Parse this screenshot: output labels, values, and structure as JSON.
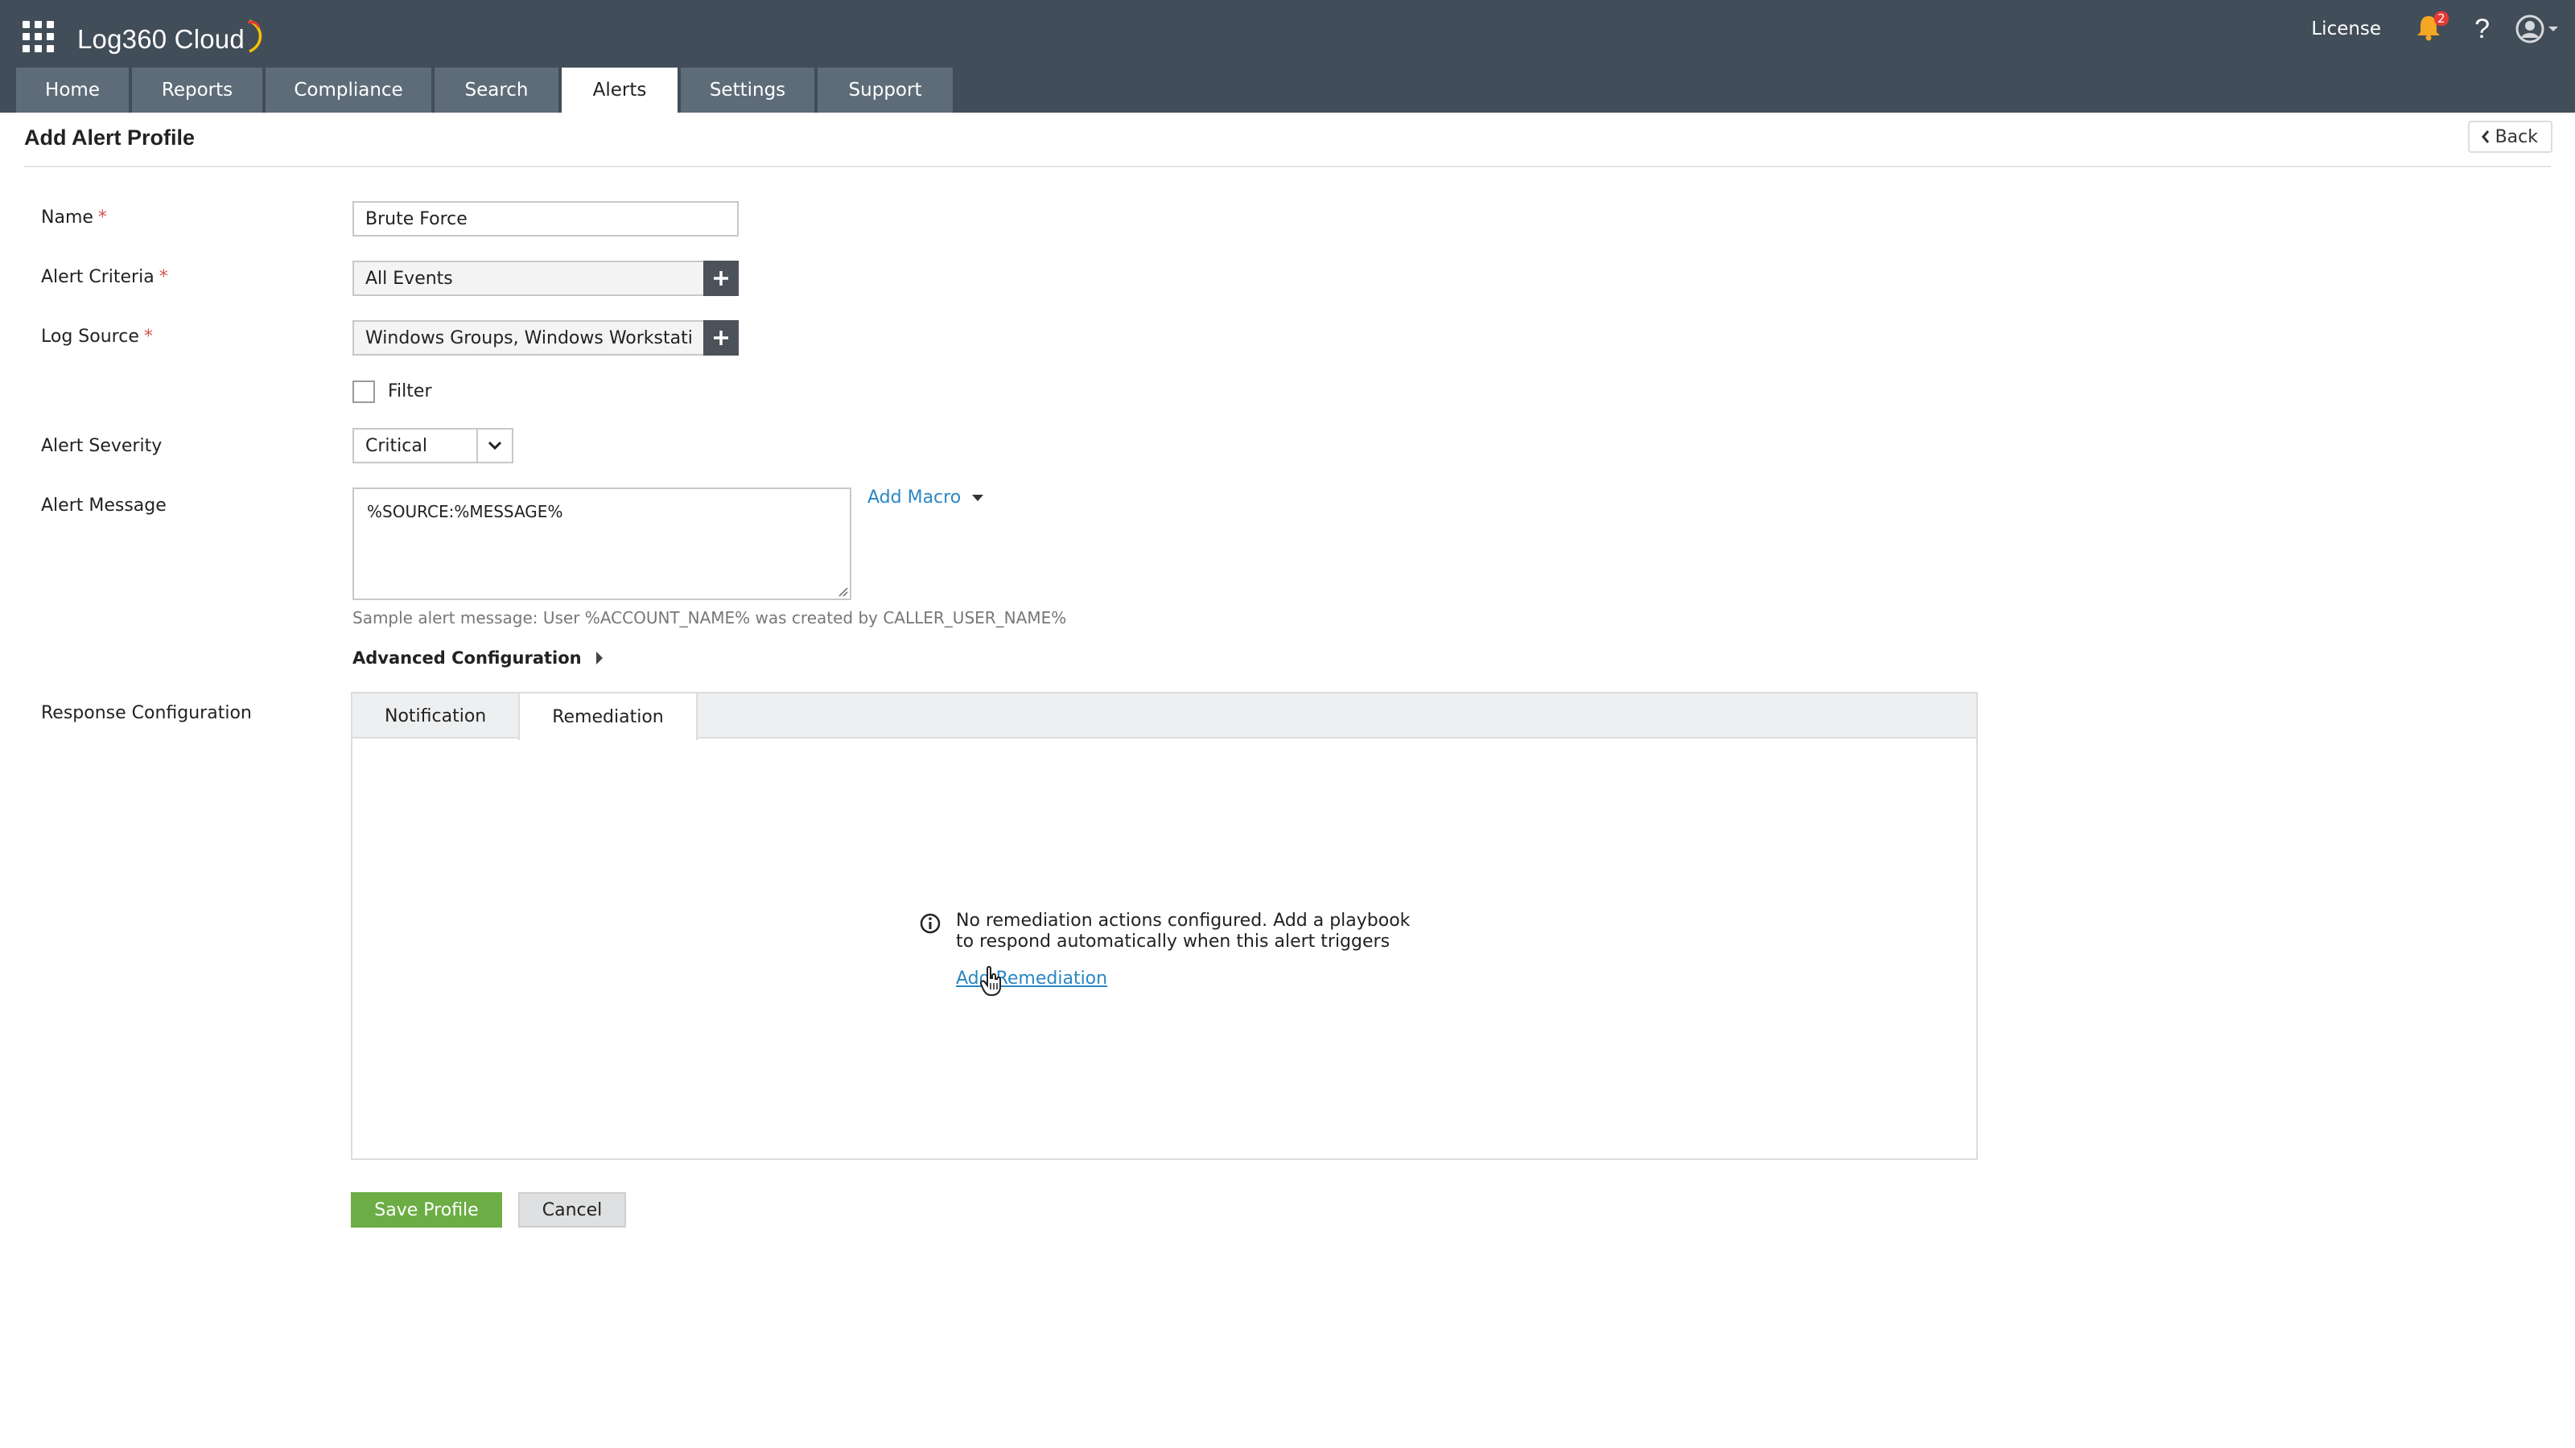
{
  "app": {
    "brand": "Log360 Cloud",
    "license_label": "License",
    "notification_count": "2",
    "help_label": "?"
  },
  "nav": {
    "tabs": [
      {
        "label": "Home"
      },
      {
        "label": "Reports"
      },
      {
        "label": "Compliance"
      },
      {
        "label": "Search"
      },
      {
        "label": "Alerts"
      },
      {
        "label": "Settings"
      },
      {
        "label": "Support"
      }
    ],
    "active": "Alerts"
  },
  "page": {
    "title": "Add Alert Profile",
    "back_label": "Back"
  },
  "form": {
    "name_label": "Name",
    "name_value": "Brute Force",
    "criteria_label": "Alert Criteria",
    "criteria_value": "All Events",
    "log_source_label": "Log Source",
    "log_source_value": "Windows Groups, Windows Workstati",
    "filter_label": "Filter",
    "filter_checked": false,
    "severity_label": "Alert Severity",
    "severity_value": "Critical",
    "message_label": "Alert Message",
    "message_value": "%SOURCE:%MESSAGE%",
    "add_macro_label": "Add Macro",
    "message_hint": "Sample alert message: User %ACCOUNT_NAME% was created by CALLER_USER_NAME%",
    "advanced_label": "Advanced Configuration",
    "response_label": "Response Configuration",
    "required_mark": "*"
  },
  "response": {
    "tabs": [
      {
        "label": "Notification"
      },
      {
        "label": "Remediation"
      }
    ],
    "active": "Remediation",
    "empty_line1": "No remediation actions configured. Add a playbook",
    "empty_line2": "to respond automatically when this alert triggers",
    "add_remediation_label": "Add Remediation"
  },
  "actions": {
    "save_label": "Save Profile",
    "cancel_label": "Cancel"
  },
  "colors": {
    "header_bg": "#414d58",
    "tab_bg": "#5e6c79",
    "link": "#2a87c2",
    "save_bg": "#6cad45",
    "required": "#d9534f",
    "badge": "#e53935"
  },
  "icons": {
    "app_launcher": "grid-icon",
    "notifications": "bell-icon",
    "help": "help-icon",
    "user": "user-avatar-icon",
    "back": "chevron-left-icon",
    "add": "plus-icon",
    "dropdown": "chevron-down-icon",
    "info": "info-icon",
    "cursor": "hand-pointer-icon"
  }
}
